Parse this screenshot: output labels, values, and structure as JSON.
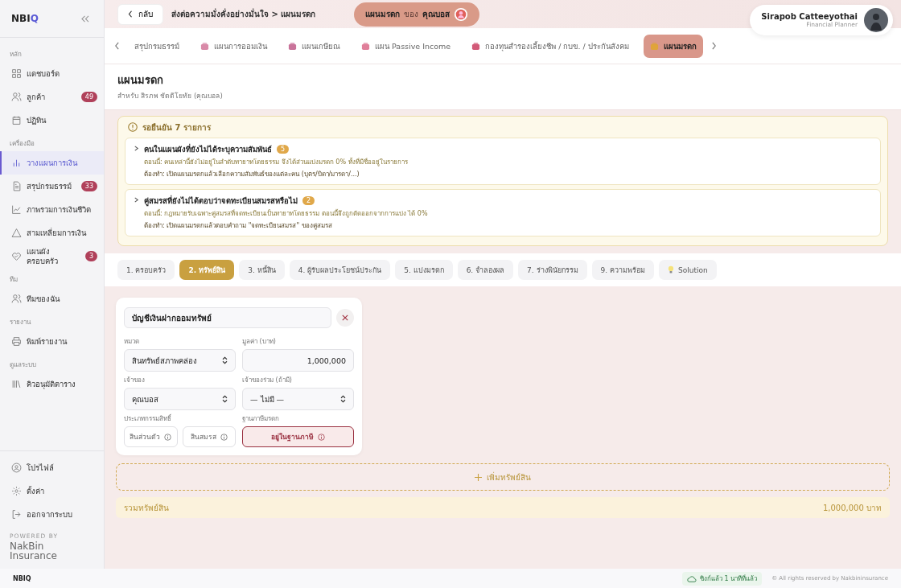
{
  "app": {
    "logo_main": "NBI",
    "logo_accent": "Q"
  },
  "sidebar": {
    "sections": [
      {
        "label": "หลัก",
        "items": [
          {
            "label": "แดชบอร์ด",
            "selected": false
          },
          {
            "label": "ลูกค้า",
            "badge": "49",
            "selected": false
          },
          {
            "label": "ปฏิทิน",
            "selected": false
          }
        ]
      },
      {
        "label": "เครื่องมือ",
        "items": [
          {
            "label": "วางแผนการเงิน",
            "selected": true
          },
          {
            "label": "สรุปกรมธรรม์",
            "badge": "33",
            "selected": false
          },
          {
            "label": "ภาพรวมการเงินชีวิต",
            "selected": false
          },
          {
            "label": "สามเหลี่ยมการเงิน",
            "selected": false
          },
          {
            "label": "แผนผังครอบครัว",
            "badge": "3",
            "selected": false
          }
        ]
      },
      {
        "label": "ทีม",
        "items": [
          {
            "label": "ทีมของฉัน",
            "selected": false
          }
        ]
      },
      {
        "label": "รายงาน",
        "items": [
          {
            "label": "พิมพ์รายงาน",
            "selected": false
          }
        ]
      },
      {
        "label": "ดูแลระบบ",
        "items": [
          {
            "label": "คิวอนุมัติตาราง",
            "selected": false
          }
        ]
      }
    ],
    "bottom_items": [
      "โปรไฟล์",
      "ตั้งค่า",
      "ออกจากระบบ"
    ],
    "powered_by": "POWERED BY",
    "brand": [
      "NakBin",
      "Insurance"
    ]
  },
  "topbar": {
    "back": "กลับ",
    "breadcrumb": "ส่งต่อความมั่งคั่งอย่างมั่นใจ > แผนมรดก",
    "plan_pill": {
      "plan": "แผนมรดก",
      "of": "ของ",
      "client": "คุณบอส"
    },
    "user": {
      "name": "Sirapob Catteeyothai",
      "role": "Financial Planner"
    }
  },
  "plan_tabs": [
    {
      "label": "สรุปกรมธรรม์",
      "selected": false
    },
    {
      "label": "แผนการออมเงิน",
      "selected": false
    },
    {
      "label": "แผนเกษียณ",
      "selected": false
    },
    {
      "label": "แผน Passive Income",
      "selected": false
    },
    {
      "label": "กองทุนสำรองเลี้ยงชีพ / กบข. / ประกันสังคม",
      "selected": false
    },
    {
      "label": "แผนมรดก",
      "selected": true
    }
  ],
  "page": {
    "title": "แผนมรดก",
    "subtitle": "สำหรับ สิรภพ ชัตติโยทัย (คุณบอล)"
  },
  "alert": {
    "title": "รอยืนยัน 7 รายการ",
    "items": [
      {
        "title": "คนในแผนผังที่ยังไม่ได้ระบุความสัมพันธ์",
        "count": "5",
        "expanded": false,
        "now": "ตอนนี้: คนเหล่านี้ยังไม่อยู่ในลำดับทายาทโดยธรรม จึงได้ส่วนแบ่งมรดก 0% ทั้งที่มีชื่ออยู่ในรายการ",
        "todo": "ต้องทำ: เปิดแผนมรดกแล้วเลือกความสัมพันธ์ของแต่ละคน (บุตร/บิดา/มารดา/...)"
      },
      {
        "title": "คู่สมรสที่ยังไม่ได้ตอบว่าจดทะเบียนสมรสหรือไม่",
        "count": "2",
        "expanded": false,
        "now": "ตอนนี้: กฎหมายรับเฉพาะคู่สมรสที่จดทะเบียนเป็นทายาทโดยธรรม ตอนนี้จึงถูกตัดออกจากการแบ่ง ได้ 0%",
        "todo": "ต้องทำ: เปิดแผนมรดกแล้วตอบคำถาม \"จดทะเบียนสมรส\" ของคู่สมรส"
      }
    ]
  },
  "steps": [
    {
      "label": "1. ครอบครัว",
      "selected": false
    },
    {
      "label": "2. ทรัพย์สิน",
      "selected": true
    },
    {
      "label": "3. หนี้สิน",
      "selected": false
    },
    {
      "label": "4. ผู้รับผลประโยชน์ประกัน",
      "selected": false
    },
    {
      "label": "5. แบ่งมรดก",
      "selected": false
    },
    {
      "label": "6. จำลองผล",
      "selected": false
    },
    {
      "label": "7. ร่างพินัยกรรม",
      "selected": false
    },
    {
      "label": "9. ความพร้อม",
      "selected": false
    },
    {
      "label": "Solution",
      "selected": false,
      "kind": "solution"
    }
  ],
  "asset_card": {
    "name": "บัญชีเงินฝากออมทรัพย์",
    "fields": [
      {
        "label": "หมวด",
        "value": "สินทรัพย์สภาพคล่อง",
        "kind": "select"
      },
      {
        "label": "มูลค่า (บาท)",
        "value": "1,000,000",
        "kind": "number"
      },
      {
        "label": "เจ้าของ",
        "value": "คุณบอส",
        "kind": "select"
      },
      {
        "label": "เจ้าของร่วม (ถ้ามี)",
        "value": "— ไม่มี —",
        "kind": "select"
      }
    ],
    "ownership": {
      "label": "ประเภทกรรมสิทธิ์",
      "options": [
        {
          "label": "สินส่วนตัว",
          "selected": false
        },
        {
          "label": "สินสมรส",
          "selected": false
        }
      ]
    },
    "tax_base": {
      "label": "ฐานภาษีมรดก",
      "option": {
        "label": "อยู่ในฐานภาษี",
        "selected": true
      }
    }
  },
  "add_asset": "เพิ่มทรัพย์สิน",
  "total": {
    "label": "รวมทรัพย์สิน",
    "value": "1,000,000 บาท"
  },
  "footer": {
    "logo": "NBIQ",
    "sync": "ซิงก์แล้ว 1 นาทีที่แล้ว",
    "copyright": "© All rights reserved by Nakbininsurance"
  }
}
